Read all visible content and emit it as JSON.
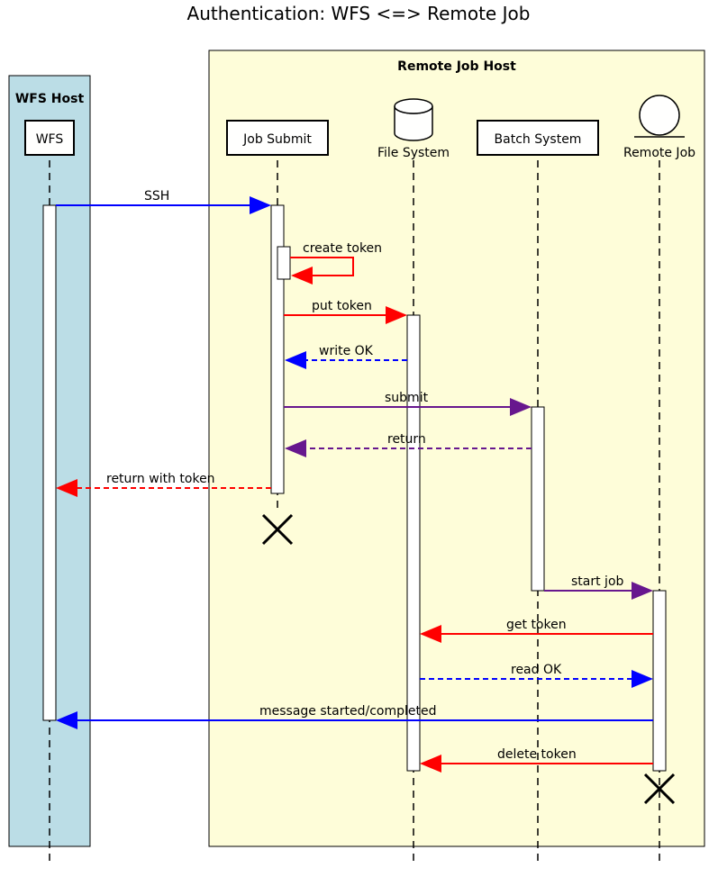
{
  "title": "Authentication: WFS <=> Remote Job",
  "boxes": {
    "wfs_host": "WFS Host",
    "remote_job_host": "Remote Job Host"
  },
  "participants": {
    "wfs": "WFS",
    "job_submit": "Job Submit",
    "file_system": "File System",
    "batch_system": "Batch System",
    "remote_job": "Remote Job"
  },
  "messages": {
    "ssh": "SSH",
    "create_token": "create token",
    "put_token": "put token",
    "write_ok": "write OK",
    "submit": "submit",
    "return": "return",
    "return_with_token": "return with token",
    "start_job": "start job",
    "get_token": "get token",
    "read_ok": "read OK",
    "message_started_completed": "message started/completed",
    "delete_token": "delete token"
  },
  "colors": {
    "wfs_box_fill": "#bbdde6",
    "remote_box_fill": "#fefdd9",
    "arrow_blue": "#0000ff",
    "arrow_red": "#ff0000",
    "arrow_purple": "#67178e"
  }
}
